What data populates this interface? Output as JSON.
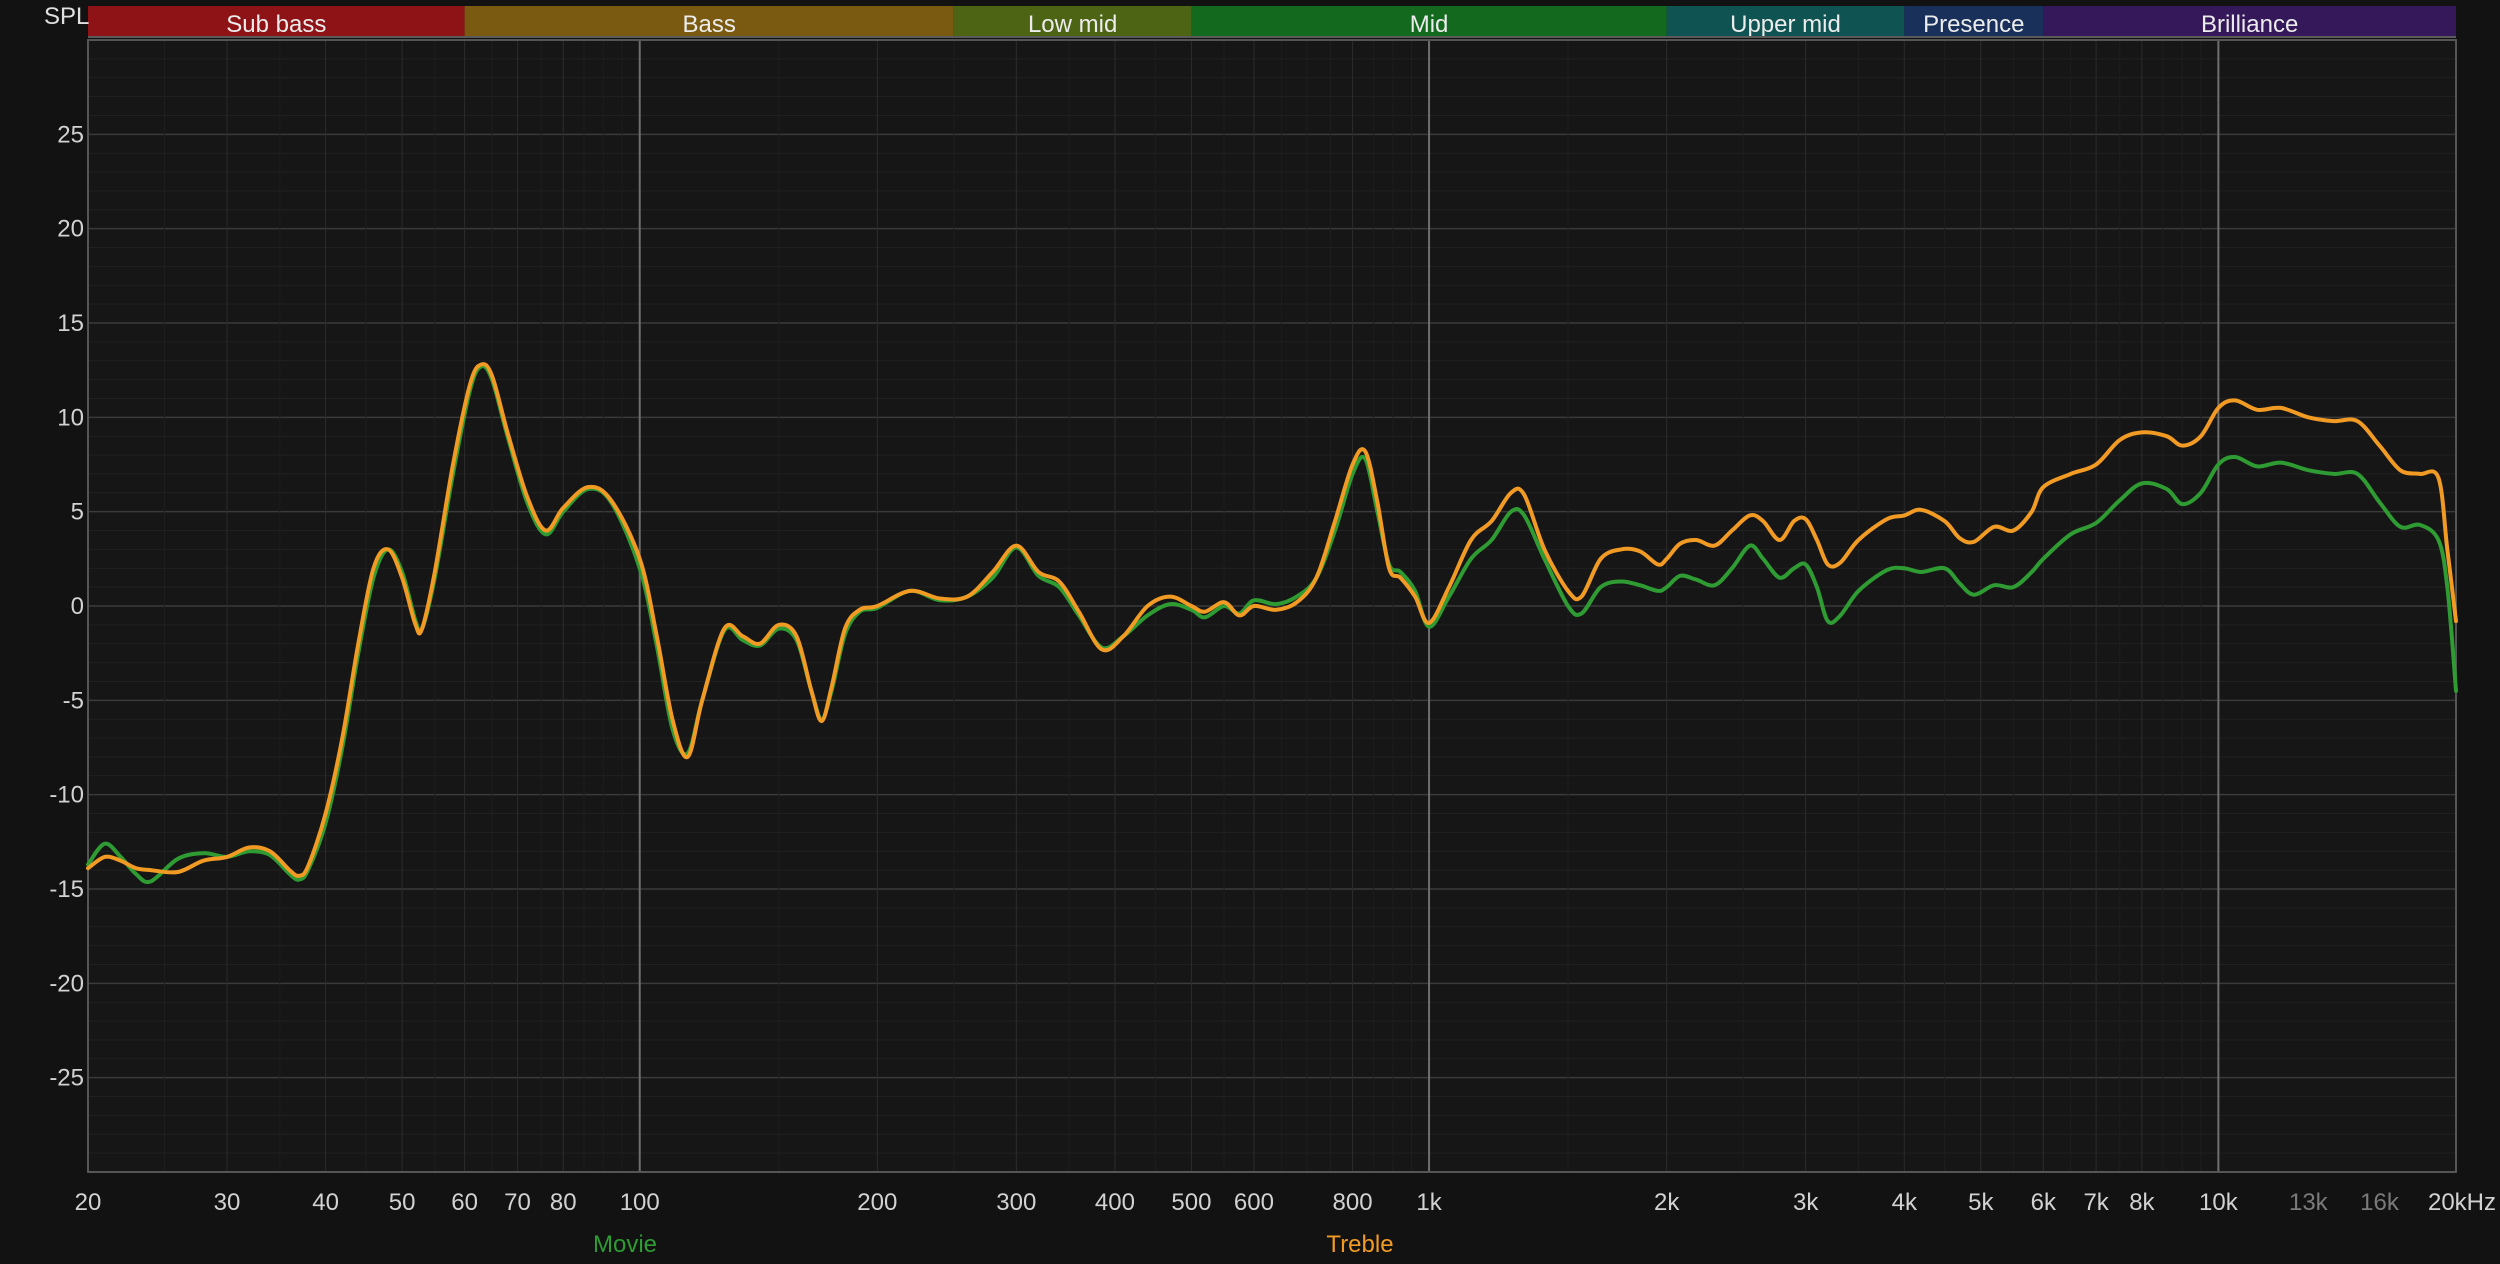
{
  "chart_data": {
    "type": "line",
    "y_axis_label": "SPL",
    "x_scale": "log",
    "xlim": [
      20,
      20000
    ],
    "ylim": [
      -30,
      30
    ],
    "grid": true,
    "y_ticks": [
      25,
      20,
      15,
      10,
      5,
      0,
      -5,
      -10,
      -15,
      -20,
      -25
    ],
    "x_ticks": [
      {
        "value": 20,
        "label": "20"
      },
      {
        "value": 30,
        "label": "30"
      },
      {
        "value": 40,
        "label": "40"
      },
      {
        "value": 50,
        "label": "50"
      },
      {
        "value": 60,
        "label": "60"
      },
      {
        "value": 70,
        "label": "70"
      },
      {
        "value": 80,
        "label": "80"
      },
      {
        "value": 100,
        "label": "100"
      },
      {
        "value": 200,
        "label": "200"
      },
      {
        "value": 300,
        "label": "300"
      },
      {
        "value": 400,
        "label": "400"
      },
      {
        "value": 500,
        "label": "500"
      },
      {
        "value": 600,
        "label": "600"
      },
      {
        "value": 800,
        "label": "800"
      },
      {
        "value": 1000,
        "label": "1k"
      },
      {
        "value": 2000,
        "label": "2k"
      },
      {
        "value": 3000,
        "label": "3k"
      },
      {
        "value": 4000,
        "label": "4k"
      },
      {
        "value": 5000,
        "label": "5k"
      },
      {
        "value": 6000,
        "label": "6k"
      },
      {
        "value": 7000,
        "label": "7k"
      },
      {
        "value": 8000,
        "label": "8k"
      },
      {
        "value": 10000,
        "label": "10k"
      },
      {
        "value": 13000,
        "label": "13k",
        "dim": true
      },
      {
        "value": 16000,
        "label": "16k",
        "dim": true
      },
      {
        "value": 20000,
        "label": "20kHz"
      }
    ],
    "bands": [
      {
        "name": "Sub bass",
        "from": 20,
        "to": 60,
        "color": "#8d1316"
      },
      {
        "name": "Bass",
        "from": 60,
        "to": 250,
        "color": "#7a5a10"
      },
      {
        "name": "Low mid",
        "from": 250,
        "to": 500,
        "color": "#4d6414"
      },
      {
        "name": "Mid",
        "from": 500,
        "to": 2000,
        "color": "#136a1e"
      },
      {
        "name": "Upper mid",
        "from": 2000,
        "to": 4000,
        "color": "#0f5452"
      },
      {
        "name": "Presence",
        "from": 4000,
        "to": 6000,
        "color": "#18305a"
      },
      {
        "name": "Brilliance",
        "from": 6000,
        "to": 20000,
        "color": "#34185a"
      }
    ],
    "series": [
      {
        "name": "Movie",
        "color": "#2e9b33",
        "points": [
          [
            20,
            -13.7
          ],
          [
            21,
            -12.6
          ],
          [
            22,
            -13.3
          ],
          [
            23,
            -14.2
          ],
          [
            24,
            -14.6
          ],
          [
            26,
            -13.4
          ],
          [
            28,
            -13.1
          ],
          [
            30,
            -13.3
          ],
          [
            32,
            -13.0
          ],
          [
            34,
            -13.2
          ],
          [
            36,
            -14.2
          ],
          [
            37,
            -14.5
          ],
          [
            38,
            -14.0
          ],
          [
            40,
            -11.5
          ],
          [
            42,
            -7.5
          ],
          [
            44,
            -2.5
          ],
          [
            46,
            1.5
          ],
          [
            48,
            3.0
          ],
          [
            50,
            1.8
          ],
          [
            52,
            -0.8
          ],
          [
            53,
            -1.2
          ],
          [
            55,
            1.5
          ],
          [
            58,
            7.0
          ],
          [
            61,
            11.5
          ],
          [
            63,
            12.7
          ],
          [
            65,
            12.0
          ],
          [
            68,
            9.0
          ],
          [
            72,
            5.5
          ],
          [
            76,
            3.8
          ],
          [
            80,
            5.0
          ],
          [
            86,
            6.2
          ],
          [
            92,
            5.5
          ],
          [
            100,
            2.0
          ],
          [
            105,
            -2.0
          ],
          [
            110,
            -6.5
          ],
          [
            115,
            -7.8
          ],
          [
            120,
            -5.0
          ],
          [
            128,
            -1.3
          ],
          [
            135,
            -1.8
          ],
          [
            142,
            -2.1
          ],
          [
            150,
            -1.2
          ],
          [
            158,
            -1.8
          ],
          [
            165,
            -4.5
          ],
          [
            170,
            -6.0
          ],
          [
            175,
            -4.5
          ],
          [
            182,
            -1.5
          ],
          [
            190,
            -0.3
          ],
          [
            200,
            -0.1
          ],
          [
            220,
            0.8
          ],
          [
            240,
            0.3
          ],
          [
            260,
            0.5
          ],
          [
            280,
            1.5
          ],
          [
            300,
            3.1
          ],
          [
            320,
            1.6
          ],
          [
            340,
            1.0
          ],
          [
            360,
            -0.5
          ],
          [
            385,
            -2.2
          ],
          [
            410,
            -1.6
          ],
          [
            440,
            -0.5
          ],
          [
            470,
            0.1
          ],
          [
            500,
            -0.2
          ],
          [
            520,
            -0.6
          ],
          [
            550,
            0.0
          ],
          [
            575,
            -0.4
          ],
          [
            600,
            0.3
          ],
          [
            640,
            0.1
          ],
          [
            680,
            0.5
          ],
          [
            720,
            1.5
          ],
          [
            760,
            4.0
          ],
          [
            800,
            7.0
          ],
          [
            830,
            7.8
          ],
          [
            860,
            5.0
          ],
          [
            890,
            2.2
          ],
          [
            920,
            1.8
          ],
          [
            960,
            0.8
          ],
          [
            1000,
            -1.1
          ],
          [
            1060,
            0.5
          ],
          [
            1130,
            2.5
          ],
          [
            1200,
            3.5
          ],
          [
            1270,
            5.0
          ],
          [
            1320,
            4.8
          ],
          [
            1400,
            2.5
          ],
          [
            1500,
            0.0
          ],
          [
            1560,
            -0.4
          ],
          [
            1650,
            1.0
          ],
          [
            1750,
            1.3
          ],
          [
            1850,
            1.1
          ],
          [
            1950,
            0.8
          ],
          [
            2000,
            1.0
          ],
          [
            2080,
            1.6
          ],
          [
            2180,
            1.4
          ],
          [
            2300,
            1.1
          ],
          [
            2420,
            2.0
          ],
          [
            2550,
            3.2
          ],
          [
            2650,
            2.5
          ],
          [
            2780,
            1.5
          ],
          [
            2900,
            2.0
          ],
          [
            3000,
            2.2
          ],
          [
            3100,
            1.0
          ],
          [
            3200,
            -0.8
          ],
          [
            3320,
            -0.5
          ],
          [
            3500,
            0.8
          ],
          [
            3800,
            1.9
          ],
          [
            4000,
            2.0
          ],
          [
            4200,
            1.8
          ],
          [
            4500,
            2.0
          ],
          [
            4700,
            1.2
          ],
          [
            4900,
            0.6
          ],
          [
            5200,
            1.1
          ],
          [
            5500,
            1.0
          ],
          [
            5800,
            1.8
          ],
          [
            6000,
            2.5
          ],
          [
            6500,
            3.8
          ],
          [
            7000,
            4.4
          ],
          [
            7500,
            5.6
          ],
          [
            8000,
            6.5
          ],
          [
            8600,
            6.2
          ],
          [
            9000,
            5.4
          ],
          [
            9500,
            6.0
          ],
          [
            10000,
            7.5
          ],
          [
            10500,
            7.9
          ],
          [
            11200,
            7.4
          ],
          [
            12000,
            7.6
          ],
          [
            13000,
            7.2
          ],
          [
            14000,
            7.0
          ],
          [
            15000,
            7.0
          ],
          [
            16000,
            5.5
          ],
          [
            17000,
            4.2
          ],
          [
            18000,
            4.3
          ],
          [
            19000,
            3.5
          ],
          [
            19500,
            1.0
          ],
          [
            20000,
            -4.5
          ]
        ]
      },
      {
        "name": "Treble",
        "color": "#f19a24",
        "points": [
          [
            20,
            -13.9
          ],
          [
            21,
            -13.3
          ],
          [
            22,
            -13.5
          ],
          [
            23,
            -13.9
          ],
          [
            24,
            -14.0
          ],
          [
            26,
            -14.1
          ],
          [
            28,
            -13.5
          ],
          [
            30,
            -13.3
          ],
          [
            32,
            -12.8
          ],
          [
            34,
            -13.0
          ],
          [
            36,
            -14.0
          ],
          [
            37,
            -14.3
          ],
          [
            38,
            -13.8
          ],
          [
            40,
            -11.0
          ],
          [
            42,
            -7.0
          ],
          [
            44,
            -2.0
          ],
          [
            46,
            2.0
          ],
          [
            48,
            3.0
          ],
          [
            50,
            1.5
          ],
          [
            52,
            -1.0
          ],
          [
            53,
            -1.2
          ],
          [
            55,
            1.8
          ],
          [
            58,
            7.5
          ],
          [
            61,
            11.8
          ],
          [
            63,
            12.8
          ],
          [
            65,
            12.2
          ],
          [
            68,
            9.2
          ],
          [
            72,
            5.8
          ],
          [
            76,
            4.0
          ],
          [
            80,
            5.2
          ],
          [
            86,
            6.3
          ],
          [
            92,
            5.6
          ],
          [
            100,
            2.5
          ],
          [
            105,
            -1.5
          ],
          [
            110,
            -6.0
          ],
          [
            115,
            -8.0
          ],
          [
            120,
            -5.0
          ],
          [
            128,
            -1.2
          ],
          [
            135,
            -1.6
          ],
          [
            142,
            -2.0
          ],
          [
            150,
            -1.0
          ],
          [
            158,
            -1.6
          ],
          [
            165,
            -4.5
          ],
          [
            170,
            -6.1
          ],
          [
            175,
            -4.3
          ],
          [
            182,
            -1.2
          ],
          [
            190,
            -0.2
          ],
          [
            200,
            0.0
          ],
          [
            220,
            0.8
          ],
          [
            240,
            0.4
          ],
          [
            260,
            0.5
          ],
          [
            280,
            1.8
          ],
          [
            300,
            3.2
          ],
          [
            320,
            1.8
          ],
          [
            340,
            1.3
          ],
          [
            360,
            -0.3
          ],
          [
            385,
            -2.3
          ],
          [
            410,
            -1.6
          ],
          [
            440,
            0.0
          ],
          [
            470,
            0.5
          ],
          [
            500,
            0.0
          ],
          [
            520,
            -0.3
          ],
          [
            550,
            0.2
          ],
          [
            575,
            -0.5
          ],
          [
            600,
            0.0
          ],
          [
            640,
            -0.2
          ],
          [
            680,
            0.2
          ],
          [
            720,
            1.5
          ],
          [
            760,
            4.5
          ],
          [
            800,
            7.5
          ],
          [
            830,
            8.2
          ],
          [
            860,
            5.5
          ],
          [
            890,
            2.0
          ],
          [
            920,
            1.5
          ],
          [
            960,
            0.5
          ],
          [
            1000,
            -0.9
          ],
          [
            1060,
            1.0
          ],
          [
            1130,
            3.5
          ],
          [
            1200,
            4.5
          ],
          [
            1270,
            6.0
          ],
          [
            1320,
            5.9
          ],
          [
            1400,
            3.0
          ],
          [
            1500,
            0.8
          ],
          [
            1560,
            0.5
          ],
          [
            1650,
            2.5
          ],
          [
            1750,
            3.0
          ],
          [
            1850,
            2.9
          ],
          [
            1950,
            2.2
          ],
          [
            2000,
            2.5
          ],
          [
            2080,
            3.3
          ],
          [
            2180,
            3.5
          ],
          [
            2300,
            3.2
          ],
          [
            2420,
            4.0
          ],
          [
            2550,
            4.8
          ],
          [
            2650,
            4.5
          ],
          [
            2780,
            3.5
          ],
          [
            2900,
            4.5
          ],
          [
            3000,
            4.6
          ],
          [
            3100,
            3.5
          ],
          [
            3200,
            2.2
          ],
          [
            3320,
            2.3
          ],
          [
            3500,
            3.5
          ],
          [
            3800,
            4.6
          ],
          [
            4000,
            4.8
          ],
          [
            4200,
            5.1
          ],
          [
            4500,
            4.5
          ],
          [
            4700,
            3.6
          ],
          [
            4900,
            3.4
          ],
          [
            5200,
            4.2
          ],
          [
            5500,
            4.0
          ],
          [
            5800,
            5.0
          ],
          [
            6000,
            6.3
          ],
          [
            6500,
            7.0
          ],
          [
            7000,
            7.5
          ],
          [
            7500,
            8.8
          ],
          [
            8000,
            9.2
          ],
          [
            8600,
            9.0
          ],
          [
            9000,
            8.5
          ],
          [
            9500,
            9.0
          ],
          [
            10000,
            10.5
          ],
          [
            10500,
            10.9
          ],
          [
            11200,
            10.4
          ],
          [
            12000,
            10.5
          ],
          [
            13000,
            10.0
          ],
          [
            14000,
            9.8
          ],
          [
            15000,
            9.8
          ],
          [
            16000,
            8.5
          ],
          [
            17000,
            7.2
          ],
          [
            18000,
            7.0
          ],
          [
            19000,
            6.8
          ],
          [
            19500,
            3.0
          ],
          [
            20000,
            -0.8
          ]
        ]
      }
    ]
  }
}
